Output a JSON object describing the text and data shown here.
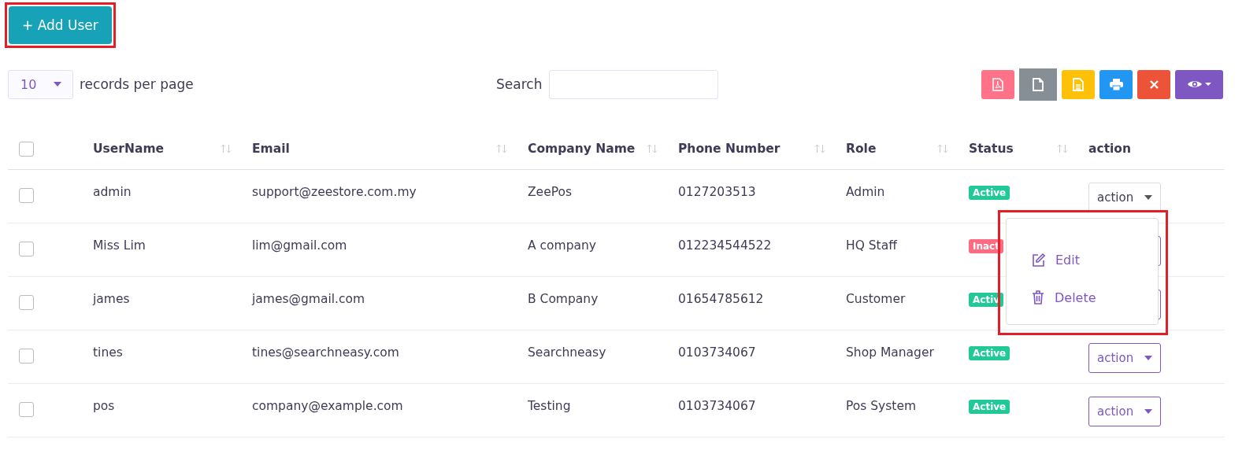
{
  "add_button": {
    "label": "+ Add User"
  },
  "page_size": {
    "value": "10",
    "label": "records per page"
  },
  "search": {
    "label": "Search"
  },
  "toolbar": [
    {
      "kind": "pdf",
      "selected": false
    },
    {
      "kind": "file",
      "selected": true
    },
    {
      "kind": "text",
      "selected": false
    },
    {
      "kind": "print",
      "selected": false
    },
    {
      "kind": "clear",
      "selected": false
    },
    {
      "kind": "view",
      "selected": false
    }
  ],
  "table": {
    "all_checked": false,
    "columns": [
      {
        "label": "UserName",
        "sortable": true
      },
      {
        "label": "Email",
        "sortable": true
      },
      {
        "label": "Company Name",
        "sortable": true
      },
      {
        "label": "Phone Number",
        "sortable": true
      },
      {
        "label": "Role",
        "sortable": true
      },
      {
        "label": "Status",
        "sortable": true
      },
      {
        "label": "action",
        "sortable": false
      }
    ],
    "rows": [
      {
        "checked": false,
        "username": "admin",
        "email": "support@zeestore.com.my",
        "company": "ZeePos",
        "phone": "0127203513",
        "role": "Admin",
        "status": {
          "label": "Active",
          "kind": "active"
        },
        "action": {
          "label": "action",
          "open": true
        }
      },
      {
        "checked": false,
        "username": "Miss Lim",
        "email": "lim@gmail.com",
        "company": "A company",
        "phone": "012234544522",
        "role": "HQ Staff",
        "status": {
          "label": "Inact",
          "kind": "inactive"
        },
        "action": {
          "open": false
        }
      },
      {
        "checked": false,
        "username": "james",
        "email": "james@gmail.com",
        "company": "B Company",
        "phone": "01654785612",
        "role": "Customer",
        "status": {
          "label": "Activ",
          "kind": "active"
        },
        "action": {
          "open": false
        }
      },
      {
        "checked": false,
        "username": "tines",
        "email": "tines@searchneasy.com",
        "company": "Searchneasy",
        "phone": "0103734067",
        "role": "Shop Manager",
        "status": {
          "label": "Active",
          "kind": "active"
        },
        "action": {
          "label": "action",
          "open": false
        }
      },
      {
        "checked": false,
        "username": "pos",
        "email": "company@example.com",
        "company": "Testing",
        "phone": "0103734067",
        "role": "Pos System",
        "status": {
          "label": "Active",
          "kind": "active"
        },
        "action": {
          "label": "action",
          "open": false
        }
      }
    ]
  },
  "action_menu": [
    {
      "label": "Edit",
      "kind": "edit"
    },
    {
      "label": "Delete",
      "kind": "delete"
    }
  ]
}
